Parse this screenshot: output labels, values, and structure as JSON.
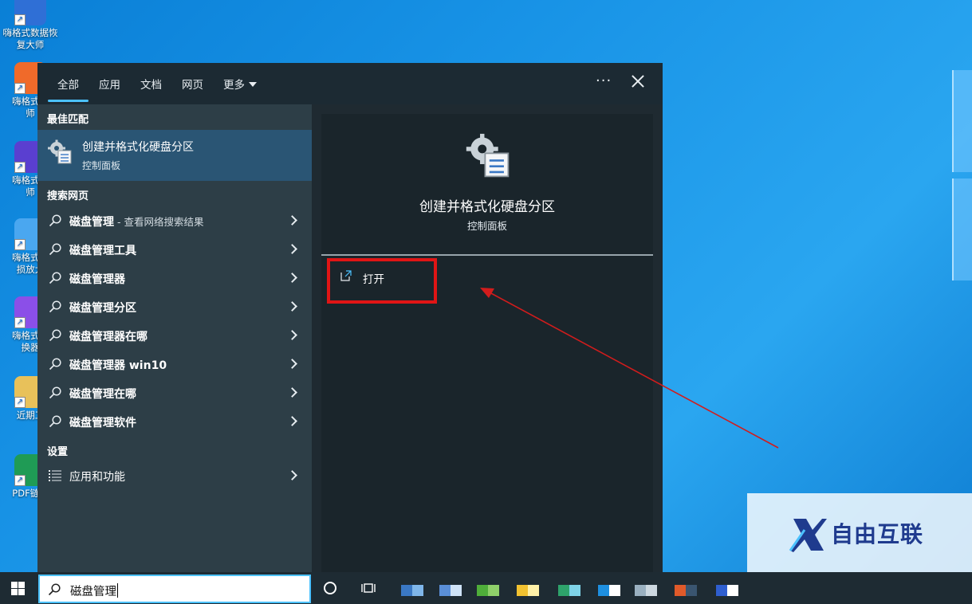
{
  "desktop": {
    "icons": [
      {
        "label_l1": "嗨格式数据恢",
        "label_l2": "复大师",
        "color": "#2f6fd6"
      },
      {
        "label_l1": "嗨格式压",
        "label_l2": "师",
        "color": "#f06a2a"
      },
      {
        "label_l1": "嗨格式剪",
        "label_l2": "师",
        "color": "#5a3fd0"
      },
      {
        "label_l1": "嗨格式图",
        "label_l2": "损放大",
        "color": "#4aa7f0"
      },
      {
        "label_l1": "嗨格式视",
        "label_l2": "换器",
        "color": "#8b4fe8"
      },
      {
        "label_l1": "近期工",
        "label_l2": "",
        "color": "#e8c15a"
      },
      {
        "label_l1": "PDF链接",
        "label_l2": "",
        "color": "#1f9b55"
      }
    ]
  },
  "panel": {
    "tabs": [
      {
        "label": "全部",
        "active": true
      },
      {
        "label": "应用",
        "active": false
      },
      {
        "label": "文档",
        "active": false
      },
      {
        "label": "网页",
        "active": false
      },
      {
        "label": "更多",
        "active": false
      }
    ],
    "ellipsis": "···",
    "best_match_heading": "最佳匹配",
    "best_match": {
      "title": "创建并格式化硬盘分区",
      "subtitle": "控制面板",
      "icon": "control-panel-icon"
    },
    "web_heading": "搜索网页",
    "web_results": [
      {
        "label": "磁盘管理",
        "hint": " - 查看网络搜索结果"
      },
      {
        "label": "磁盘管理工具",
        "hint": ""
      },
      {
        "label": "磁盘管理器",
        "hint": ""
      },
      {
        "label": "磁盘管理分区",
        "hint": ""
      },
      {
        "label": "磁盘管理器在哪",
        "hint": ""
      },
      {
        "label": "磁盘管理器 win10",
        "hint": ""
      },
      {
        "label": "磁盘管理在哪",
        "hint": ""
      },
      {
        "label": "磁盘管理软件",
        "hint": ""
      }
    ],
    "settings_heading": "设置",
    "settings_results": [
      {
        "label": "应用和功能",
        "icon": "list-icon"
      }
    ],
    "detail": {
      "title": "创建并格式化硬盘分区",
      "subtitle": "控制面板",
      "actions": [
        {
          "label": "打开",
          "icon": "open-icon"
        }
      ]
    }
  },
  "taskbar": {
    "search_value": "磁盘管理"
  },
  "watermark": {
    "text": "自由互联"
  },
  "colors": {
    "accent": "#4cc2ff",
    "highlight": "#e01515",
    "arrow": "#d21c1c"
  }
}
